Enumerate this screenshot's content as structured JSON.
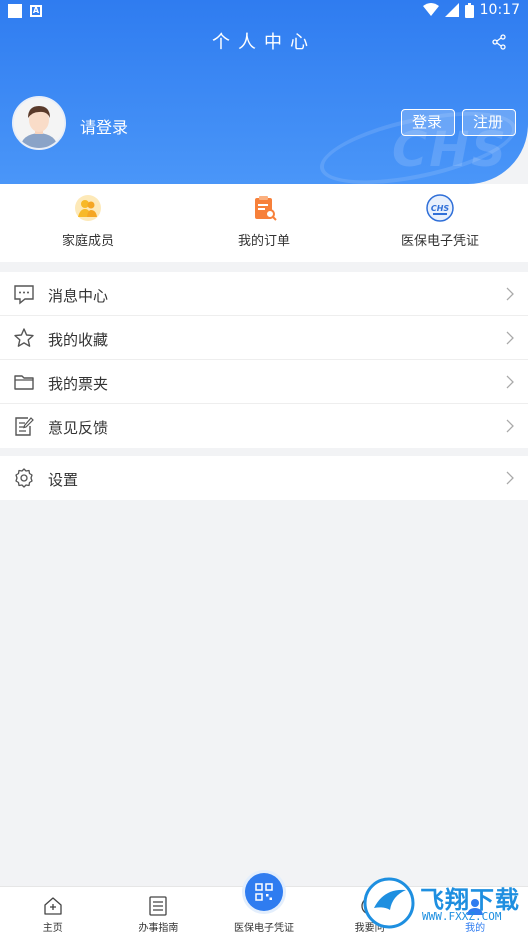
{
  "status_bar": {
    "time": "10:17"
  },
  "header": {
    "title": "个人中心",
    "watermark": "CHS",
    "login_prompt": "请登录",
    "login_button": "登录",
    "register_button": "注册",
    "accent_color": "#2f7cf0"
  },
  "shortcuts": [
    {
      "label": "家庭成员",
      "icon": "family-icon"
    },
    {
      "label": "我的订单",
      "icon": "order-icon"
    },
    {
      "label": "医保电子凭证",
      "icon": "chs-badge-icon"
    }
  ],
  "menu_main": [
    {
      "label": "消息中心",
      "icon": "message-icon"
    },
    {
      "label": "我的收藏",
      "icon": "star-icon"
    },
    {
      "label": "我的票夹",
      "icon": "folder-icon"
    },
    {
      "label": "意见反馈",
      "icon": "feedback-icon"
    }
  ],
  "menu_settings": [
    {
      "label": "设置",
      "icon": "gear-icon"
    }
  ],
  "tabbar": [
    {
      "label": "主页",
      "icon": "home-icon"
    },
    {
      "label": "办事指南",
      "icon": "guide-icon"
    },
    {
      "label": "医保电子凭证",
      "icon": "qr-code-icon"
    },
    {
      "label": "我要问",
      "icon": "question-icon"
    },
    {
      "label": "我的",
      "icon": "user-icon",
      "active": true
    }
  ],
  "logo_watermark": {
    "text": "飞翔下载",
    "url": "WWW.FXXZ.COM"
  }
}
